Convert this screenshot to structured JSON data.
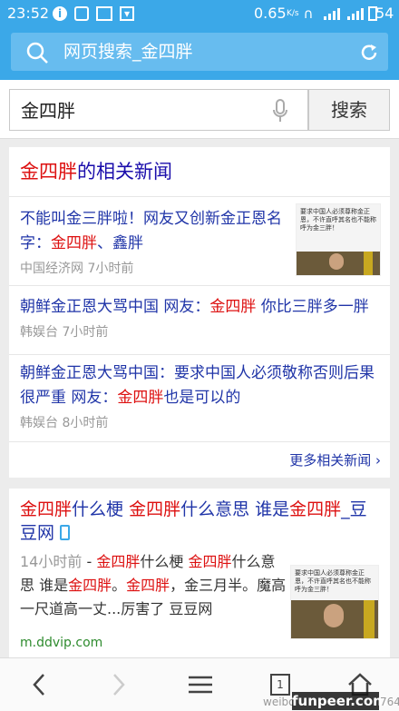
{
  "status": {
    "time": "23:52",
    "speed": "0.65",
    "speed_unit": "K/s",
    "battery": "54",
    "icons": [
      "info-icon",
      "notification-icon",
      "image-icon",
      "download-icon",
      "headphone-icon",
      "signal-icon",
      "wifi-icon",
      "battery-icon"
    ]
  },
  "urlbar": {
    "text": "网页搜索_金四胖",
    "icon_left": "search-icon",
    "icon_right": "refresh-icon"
  },
  "search": {
    "query": "金四胖",
    "button": "搜索",
    "mic": "microphone-icon"
  },
  "news": {
    "heading_red": "金四胖",
    "heading_rest": "的相关新闻",
    "items": [
      {
        "title_a": "不能叫金三胖啦！网友又创新金正恩名字：",
        "title_red1": "金四胖",
        "title_b": "、鑫胖",
        "source": "中国经济网",
        "time": "7小时前",
        "thumb_text": "要求中国人必须尊称金正恩，不许直呼其名也不能称呼为金三胖！"
      },
      {
        "title_a": "朝鲜金正恩大骂中国 网友：",
        "title_red1": "金四胖",
        "title_b": " 你比三胖多一胖",
        "source": "韩娱台",
        "time": "7小时前"
      },
      {
        "title_a": "朝鲜金正恩大骂中国：要求中国人必须敬称否则后果很严重 网友：",
        "title_red1": "金四胖",
        "title_b": "也是可以的",
        "source": "韩娱台",
        "time": "8小时前"
      }
    ],
    "more": "更多相关新闻"
  },
  "result": {
    "title_parts": [
      "金四胖",
      "什么梗 ",
      "金四胖",
      "什么意思 谁是",
      "金四胖",
      "_豆豆网"
    ],
    "snippet_time": "14小时前",
    "snippet_parts": [
      "金四胖",
      "什么梗 ",
      "金四胖",
      "什么意思 谁是",
      "金四胖",
      "。",
      "金四胖",
      "，金三月半。魔高一尺道高一丈...厉害了 豆豆网"
    ],
    "url": "m.ddvip.com",
    "thumb_text": "要求中国人必须尊称金正恩，不许直呼其名也不能称呼为金三胖！"
  },
  "nav": {
    "tabs_count": "1",
    "icons": [
      "back-icon",
      "forward-icon",
      "menu-icon",
      "tabs-icon",
      "home-icon"
    ]
  },
  "watermark": {
    "left": "weibo",
    "right": "funpeer.com",
    "tail": "764"
  },
  "colors": {
    "accent": "#3ba8e8",
    "link": "#2035a8",
    "highlight": "#dd1111",
    "url": "#2e8b2e"
  }
}
